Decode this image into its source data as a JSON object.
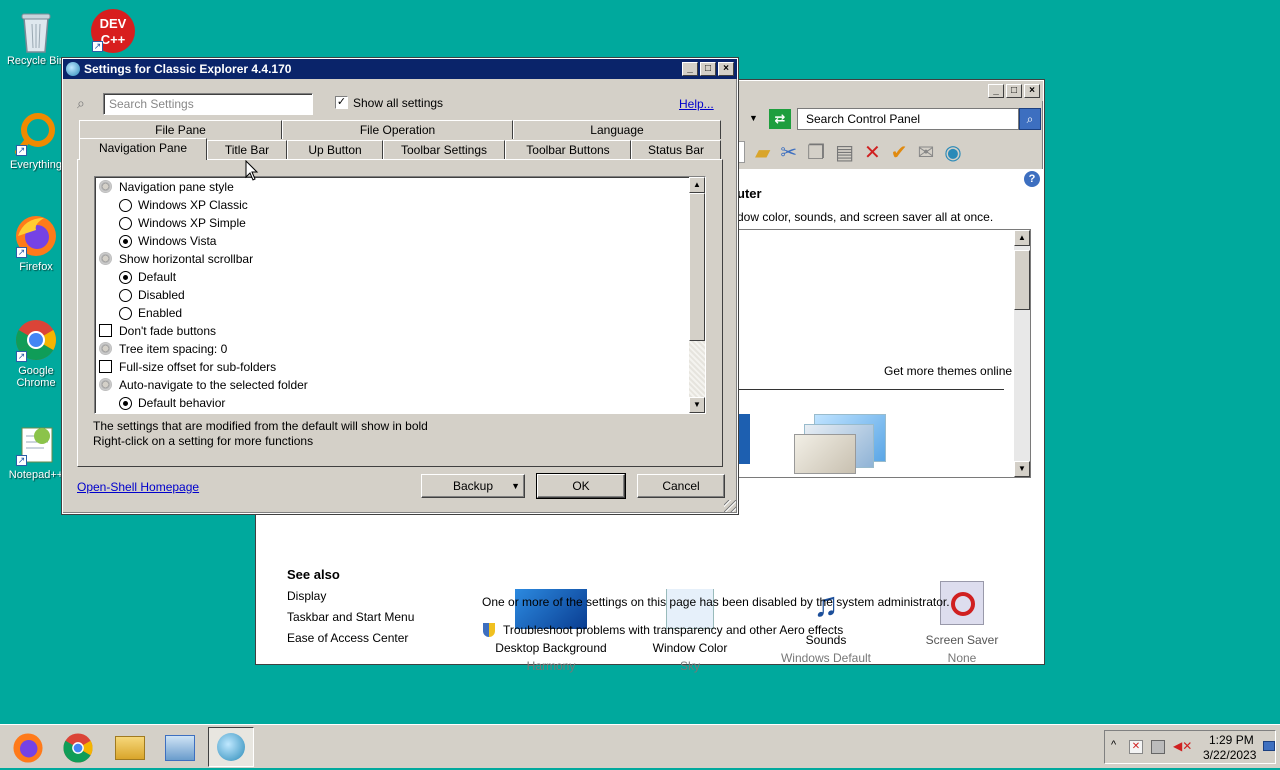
{
  "desktop": {
    "icons": [
      {
        "label": "Recycle Bin",
        "icon": "recycle-bin-icon"
      },
      {
        "label": "DEV C++",
        "icon": "devcpp-icon"
      },
      {
        "label": "Everything",
        "icon": "everything-icon"
      },
      {
        "label": "Firefox",
        "icon": "firefox-icon"
      },
      {
        "label": "Google Chrome",
        "icon": "chrome-icon"
      },
      {
        "label": "Notepad++",
        "icon": "notepadpp-icon"
      }
    ]
  },
  "dialog": {
    "title": "Settings for Classic Explorer 4.4.170",
    "search_placeholder": "Search Settings",
    "show_all_label": "Show all settings",
    "show_all_checked": true,
    "help_link": "Help...",
    "tabs_back": [
      "File Pane",
      "File Operation",
      "Language"
    ],
    "tabs_front": [
      "Navigation Pane",
      "Title Bar",
      "Up Button",
      "Toolbar Settings",
      "Toolbar Buttons",
      "Status Bar"
    ],
    "active_tab": "Navigation Pane",
    "settings": [
      {
        "type": "group",
        "label": "Navigation pane style"
      },
      {
        "type": "radio",
        "label": "Windows XP Classic",
        "checked": false
      },
      {
        "type": "radio",
        "label": "Windows XP Simple",
        "checked": false
      },
      {
        "type": "radio",
        "label": "Windows Vista",
        "checked": true
      },
      {
        "type": "group",
        "label": "Show horizontal scrollbar"
      },
      {
        "type": "radio",
        "label": "Default",
        "checked": true
      },
      {
        "type": "radio",
        "label": "Disabled",
        "checked": false
      },
      {
        "type": "radio",
        "label": "Enabled",
        "checked": false
      },
      {
        "type": "check",
        "label": "Don't fade buttons",
        "checked": false
      },
      {
        "type": "group",
        "label": "Tree item spacing: 0"
      },
      {
        "type": "check",
        "label": "Full-size offset for sub-folders",
        "checked": false
      },
      {
        "type": "group",
        "label": "Auto-navigate to the selected folder"
      },
      {
        "type": "radio",
        "label": "Default behavior",
        "checked": true
      }
    ],
    "hint_line1": "The settings that are modified from the default will show in bold",
    "hint_line2": "Right-click on a setting for more functions",
    "homepage_link": "Open-Shell Homepage",
    "backup_button": "Backup",
    "ok_button": "OK",
    "cancel_button": "Cancel"
  },
  "control_panel": {
    "search_placeholder": "Search Control Panel",
    "heading_fragment": "uter",
    "desc_fragment": "dow color, sounds, and screen saver all at once.",
    "more_themes": "Get more themes online",
    "items": [
      {
        "label": "Desktop Background",
        "sub": "Harmony",
        "icon": "desktop-background-icon"
      },
      {
        "label": "Window Color",
        "sub": "Sky",
        "icon": "window-color-icon"
      },
      {
        "label": "Sounds",
        "sub": "Windows Default",
        "icon": "sounds-icon"
      },
      {
        "label": "Screen Saver",
        "sub": "None",
        "icon": "screen-saver-icon"
      }
    ],
    "see_also_title": "See also",
    "see_also": [
      "Display",
      "Taskbar and Start Menu",
      "Ease of Access Center"
    ],
    "admin_note": "One or more of the settings on this page has been disabled by the system administrator.",
    "troubleshoot_link": "Troubleshoot problems with transparency and other Aero effects"
  },
  "taskbar": {
    "time": "1:29 PM",
    "date": "3/22/2023",
    "tray_up_glyph": "^"
  }
}
